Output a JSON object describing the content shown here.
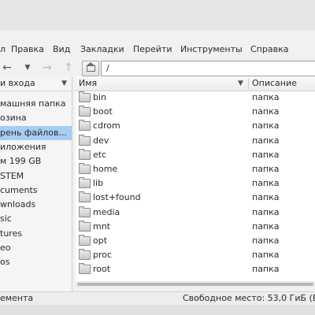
{
  "menu": [
    "Правка",
    "Вид",
    "Закладки",
    "Перейти",
    "Инструменты",
    "Справка"
  ],
  "menu_leading": "л",
  "toolbar": {
    "back_icon": "←",
    "back_dropdown_icon": "▼",
    "forward_icon": "→",
    "up_icon": "↑"
  },
  "location": "/",
  "sidebar": {
    "header": "и входа",
    "items": [
      {
        "label": "машняя папка",
        "selected": false
      },
      {
        "label": "озина",
        "selected": false
      },
      {
        "label": "рень файлов...",
        "selected": true
      },
      {
        "label": "иложения",
        "selected": false
      },
      {
        "label": "м 199 GB",
        "selected": false
      },
      {
        "label": "STEM",
        "selected": false
      },
      {
        "label": "cuments",
        "selected": false
      },
      {
        "label": "wnloads",
        "selected": false
      },
      {
        "label": "sic",
        "selected": false
      },
      {
        "label": "tures",
        "selected": false
      },
      {
        "label": "eo",
        "selected": false
      },
      {
        "label": "os",
        "selected": false
      }
    ]
  },
  "columns": {
    "name": "Имя",
    "sort_icon": "▼",
    "description": "Описание"
  },
  "files": [
    {
      "name": "bin",
      "desc": "папка"
    },
    {
      "name": "boot",
      "desc": "папка"
    },
    {
      "name": "cdrom",
      "desc": "папка"
    },
    {
      "name": "dev",
      "desc": "папка"
    },
    {
      "name": "etc",
      "desc": "папка"
    },
    {
      "name": "home",
      "desc": "папка"
    },
    {
      "name": "lib",
      "desc": "папка"
    },
    {
      "name": "lost+found",
      "desc": "папка"
    },
    {
      "name": "media",
      "desc": "папка"
    },
    {
      "name": "mnt",
      "desc": "папка"
    },
    {
      "name": "opt",
      "desc": "папка"
    },
    {
      "name": "proc",
      "desc": "папка"
    },
    {
      "name": "root",
      "desc": "папка"
    }
  ],
  "status": {
    "left": "емента",
    "right": "Свободное место: 53,0 ГиБ (В"
  }
}
